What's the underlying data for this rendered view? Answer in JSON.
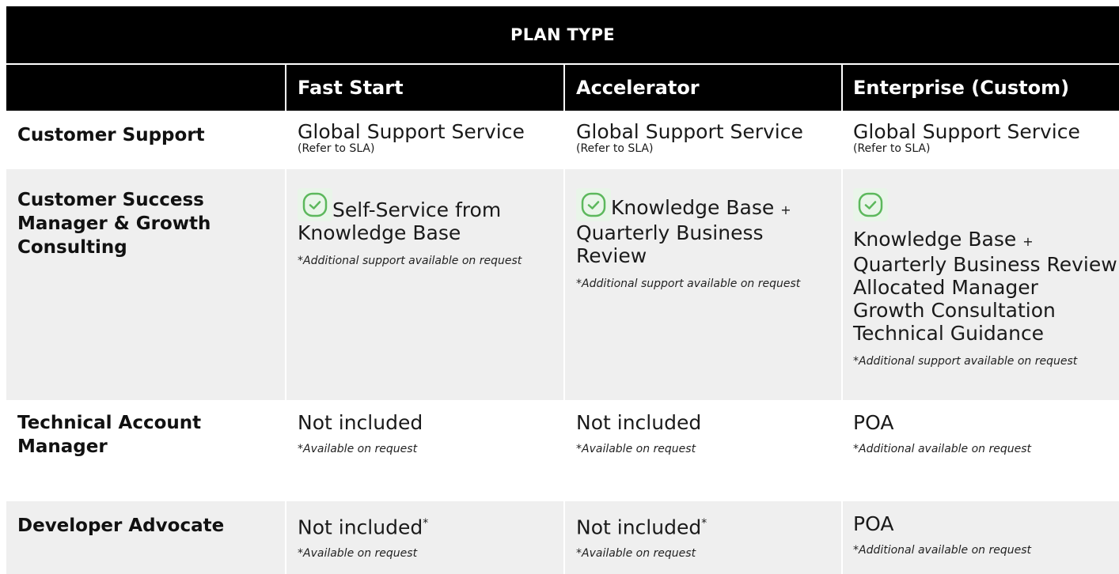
{
  "header": {
    "plan_type": "PLAN TYPE",
    "columns": [
      "",
      "Fast Start",
      "Accelerator",
      "Enterprise (Custom)"
    ]
  },
  "rows": {
    "customer_support": {
      "label": "Customer Support",
      "cells": [
        {
          "main": "Global Support Service",
          "sub": "(Refer to SLA)"
        },
        {
          "main": "Global Support Service",
          "sub": "(Refer to SLA)"
        },
        {
          "main": "Global Support Service",
          "sub": "(Refer to SLA)"
        }
      ]
    },
    "csm": {
      "label_lines": [
        "Customer Success",
        "Manager & Growth",
        "Consulting"
      ],
      "fast_start": {
        "line1": "Self-Service from",
        "line2": "Knowledge Base",
        "note": "*Additional support available on request"
      },
      "accelerator": {
        "line1": "Knowledge Base",
        "plus": "+",
        "line2": "Quarterly Business",
        "line3": "Review",
        "note": "*Additional support available on request"
      },
      "enterprise": {
        "line1": "Knowledge Base",
        "plus": "+",
        "line2": "Quarterly Business Review",
        "line3": "Allocated Manager",
        "line4": "Growth Consultation",
        "line5": "Technical Guidance",
        "note": "*Additional support available on request"
      },
      "check_icon": "check-circle-icon",
      "check_color": "#5cb85c"
    },
    "tam": {
      "label_lines": [
        "Technical Account",
        "Manager"
      ],
      "cells": [
        {
          "main": "Not included",
          "note": "*Available on request"
        },
        {
          "main": "Not included",
          "note": "*Available on request"
        },
        {
          "main": "POA",
          "note": "*Additional available on request"
        }
      ]
    },
    "dev_advocate": {
      "label": "Developer Advocate",
      "cells": [
        {
          "main": "Not included",
          "star": "*",
          "note": "*Available on request"
        },
        {
          "main": "Not included",
          "star": "*",
          "note": "*Available on request"
        },
        {
          "main": "POA",
          "star": "",
          "note": "*Additional available on request"
        }
      ]
    }
  }
}
